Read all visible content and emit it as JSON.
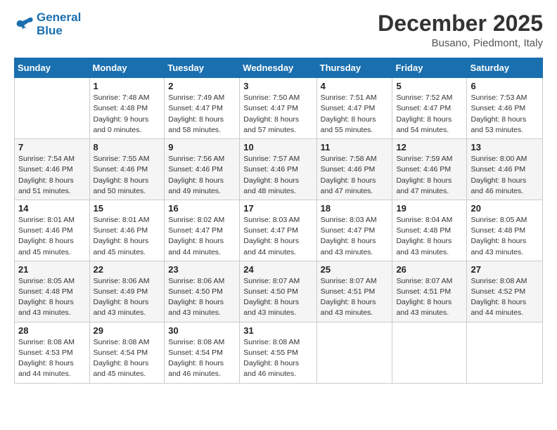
{
  "logo": {
    "line1": "General",
    "line2": "Blue"
  },
  "title": "December 2025",
  "location": "Busano, Piedmont, Italy",
  "days_header": [
    "Sunday",
    "Monday",
    "Tuesday",
    "Wednesday",
    "Thursday",
    "Friday",
    "Saturday"
  ],
  "weeks": [
    [
      {
        "day": "",
        "info": ""
      },
      {
        "day": "1",
        "info": "Sunrise: 7:48 AM\nSunset: 4:48 PM\nDaylight: 9 hours\nand 0 minutes."
      },
      {
        "day": "2",
        "info": "Sunrise: 7:49 AM\nSunset: 4:47 PM\nDaylight: 8 hours\nand 58 minutes."
      },
      {
        "day": "3",
        "info": "Sunrise: 7:50 AM\nSunset: 4:47 PM\nDaylight: 8 hours\nand 57 minutes."
      },
      {
        "day": "4",
        "info": "Sunrise: 7:51 AM\nSunset: 4:47 PM\nDaylight: 8 hours\nand 55 minutes."
      },
      {
        "day": "5",
        "info": "Sunrise: 7:52 AM\nSunset: 4:47 PM\nDaylight: 8 hours\nand 54 minutes."
      },
      {
        "day": "6",
        "info": "Sunrise: 7:53 AM\nSunset: 4:46 PM\nDaylight: 8 hours\nand 53 minutes."
      }
    ],
    [
      {
        "day": "7",
        "info": "Sunrise: 7:54 AM\nSunset: 4:46 PM\nDaylight: 8 hours\nand 51 minutes."
      },
      {
        "day": "8",
        "info": "Sunrise: 7:55 AM\nSunset: 4:46 PM\nDaylight: 8 hours\nand 50 minutes."
      },
      {
        "day": "9",
        "info": "Sunrise: 7:56 AM\nSunset: 4:46 PM\nDaylight: 8 hours\nand 49 minutes."
      },
      {
        "day": "10",
        "info": "Sunrise: 7:57 AM\nSunset: 4:46 PM\nDaylight: 8 hours\nand 48 minutes."
      },
      {
        "day": "11",
        "info": "Sunrise: 7:58 AM\nSunset: 4:46 PM\nDaylight: 8 hours\nand 47 minutes."
      },
      {
        "day": "12",
        "info": "Sunrise: 7:59 AM\nSunset: 4:46 PM\nDaylight: 8 hours\nand 47 minutes."
      },
      {
        "day": "13",
        "info": "Sunrise: 8:00 AM\nSunset: 4:46 PM\nDaylight: 8 hours\nand 46 minutes."
      }
    ],
    [
      {
        "day": "14",
        "info": "Sunrise: 8:01 AM\nSunset: 4:46 PM\nDaylight: 8 hours\nand 45 minutes."
      },
      {
        "day": "15",
        "info": "Sunrise: 8:01 AM\nSunset: 4:46 PM\nDaylight: 8 hours\nand 45 minutes."
      },
      {
        "day": "16",
        "info": "Sunrise: 8:02 AM\nSunset: 4:47 PM\nDaylight: 8 hours\nand 44 minutes."
      },
      {
        "day": "17",
        "info": "Sunrise: 8:03 AM\nSunset: 4:47 PM\nDaylight: 8 hours\nand 44 minutes."
      },
      {
        "day": "18",
        "info": "Sunrise: 8:03 AM\nSunset: 4:47 PM\nDaylight: 8 hours\nand 43 minutes."
      },
      {
        "day": "19",
        "info": "Sunrise: 8:04 AM\nSunset: 4:48 PM\nDaylight: 8 hours\nand 43 minutes."
      },
      {
        "day": "20",
        "info": "Sunrise: 8:05 AM\nSunset: 4:48 PM\nDaylight: 8 hours\nand 43 minutes."
      }
    ],
    [
      {
        "day": "21",
        "info": "Sunrise: 8:05 AM\nSunset: 4:48 PM\nDaylight: 8 hours\nand 43 minutes."
      },
      {
        "day": "22",
        "info": "Sunrise: 8:06 AM\nSunset: 4:49 PM\nDaylight: 8 hours\nand 43 minutes."
      },
      {
        "day": "23",
        "info": "Sunrise: 8:06 AM\nSunset: 4:50 PM\nDaylight: 8 hours\nand 43 minutes."
      },
      {
        "day": "24",
        "info": "Sunrise: 8:07 AM\nSunset: 4:50 PM\nDaylight: 8 hours\nand 43 minutes."
      },
      {
        "day": "25",
        "info": "Sunrise: 8:07 AM\nSunset: 4:51 PM\nDaylight: 8 hours\nand 43 minutes."
      },
      {
        "day": "26",
        "info": "Sunrise: 8:07 AM\nSunset: 4:51 PM\nDaylight: 8 hours\nand 43 minutes."
      },
      {
        "day": "27",
        "info": "Sunrise: 8:08 AM\nSunset: 4:52 PM\nDaylight: 8 hours\nand 44 minutes."
      }
    ],
    [
      {
        "day": "28",
        "info": "Sunrise: 8:08 AM\nSunset: 4:53 PM\nDaylight: 8 hours\nand 44 minutes."
      },
      {
        "day": "29",
        "info": "Sunrise: 8:08 AM\nSunset: 4:54 PM\nDaylight: 8 hours\nand 45 minutes."
      },
      {
        "day": "30",
        "info": "Sunrise: 8:08 AM\nSunset: 4:54 PM\nDaylight: 8 hours\nand 46 minutes."
      },
      {
        "day": "31",
        "info": "Sunrise: 8:08 AM\nSunset: 4:55 PM\nDaylight: 8 hours\nand 46 minutes."
      },
      {
        "day": "",
        "info": ""
      },
      {
        "day": "",
        "info": ""
      },
      {
        "day": "",
        "info": ""
      }
    ]
  ]
}
